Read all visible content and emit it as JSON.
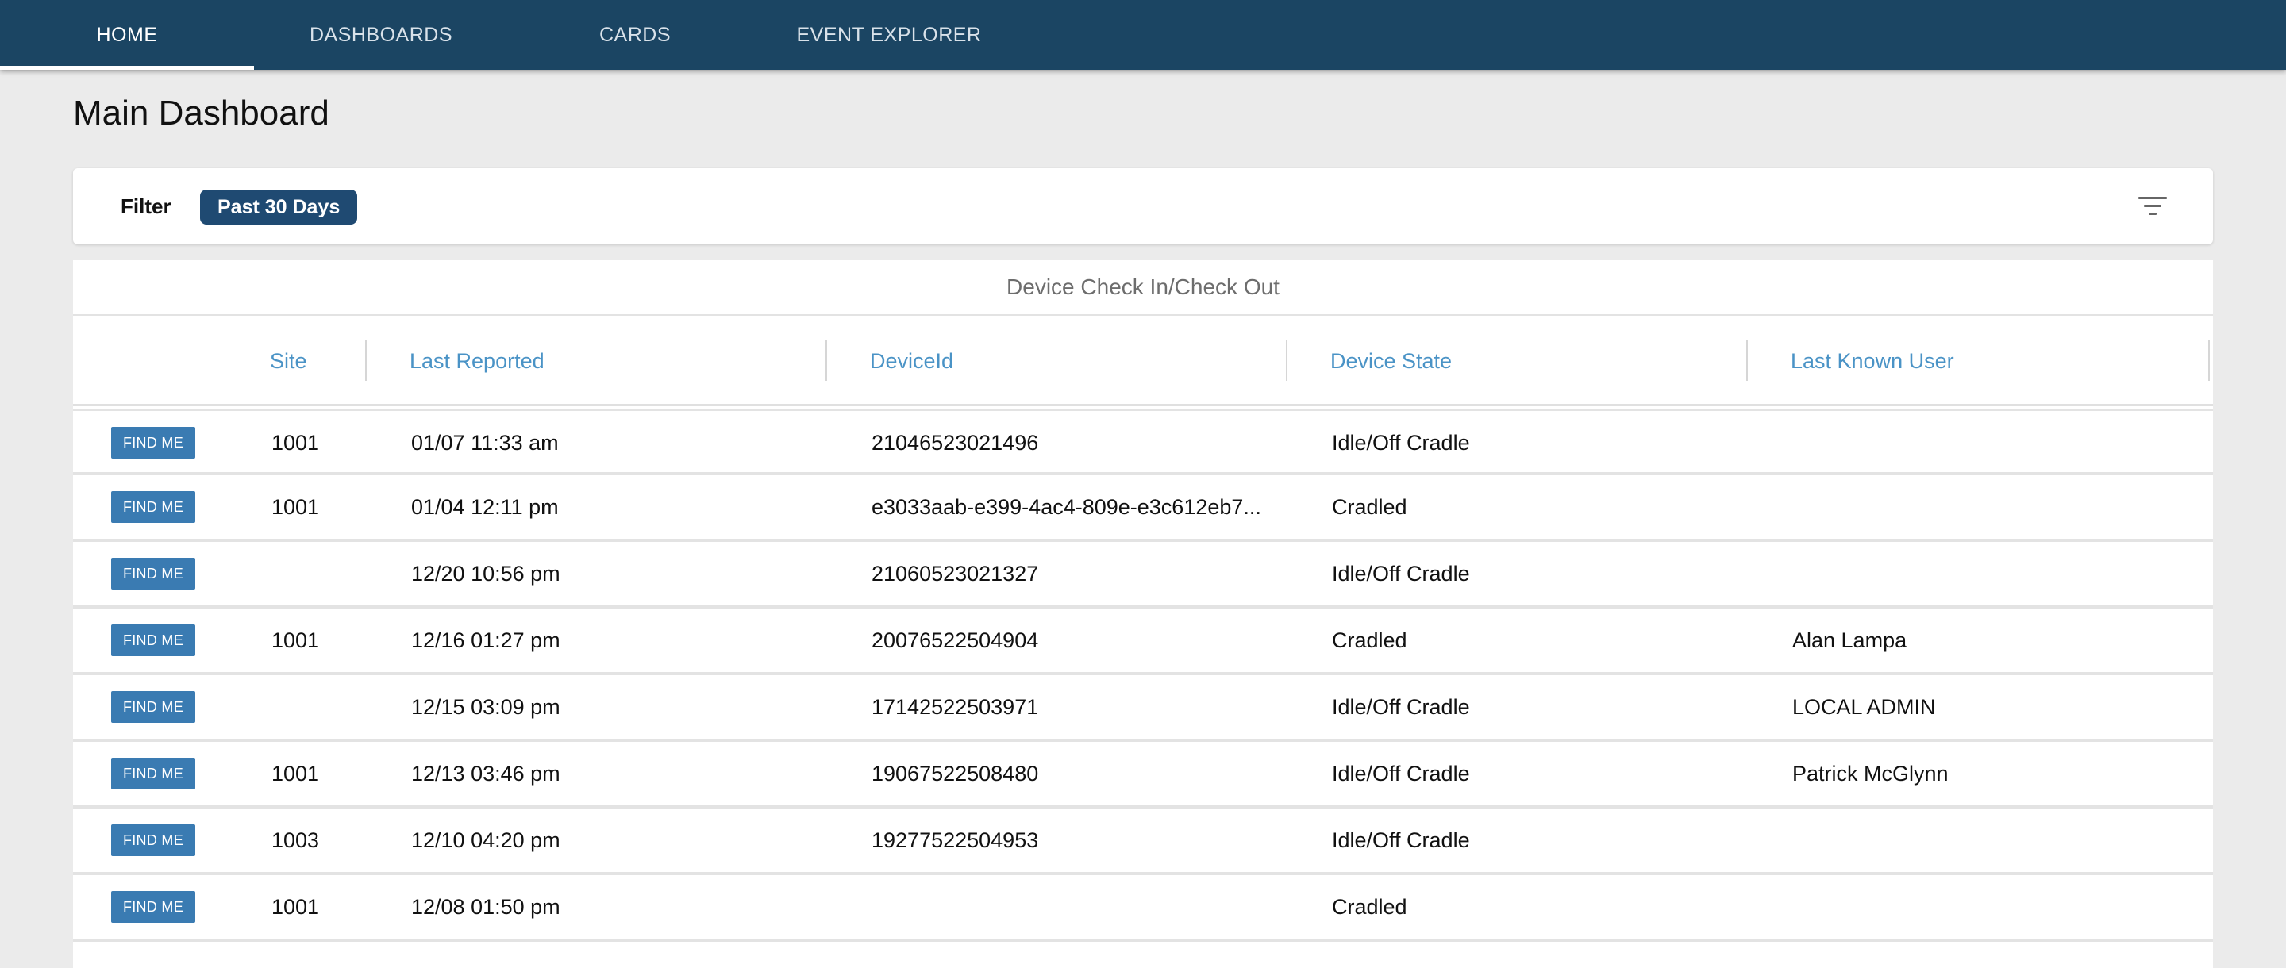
{
  "nav": {
    "tabs": [
      {
        "label": "HOME",
        "active": true
      },
      {
        "label": "DASHBOARDS",
        "active": false
      },
      {
        "label": "CARDS",
        "active": false
      },
      {
        "label": "EVENT EXPLORER",
        "active": false
      }
    ]
  },
  "page": {
    "title": "Main Dashboard"
  },
  "filter": {
    "label": "Filter",
    "chip": "Past 30 Days",
    "icon": "filter-list-icon"
  },
  "table": {
    "title": "Device Check In/Check Out",
    "columns": [
      "Site",
      "Last Reported",
      "DeviceId",
      "Device State",
      "Last Known User"
    ],
    "button_label": "FIND ME",
    "rows": [
      {
        "site": "1001",
        "last_reported": "01/07 11:33 am",
        "device_id": "21046523021496",
        "state": "Idle/Off Cradle",
        "user": ""
      },
      {
        "site": "1001",
        "last_reported": "01/04 12:11 pm",
        "device_id": "e3033aab-e399-4ac4-809e-e3c612eb7...",
        "state": "Cradled",
        "user": ""
      },
      {
        "site": "",
        "last_reported": "12/20 10:56 pm",
        "device_id": "21060523021327",
        "state": "Idle/Off Cradle",
        "user": ""
      },
      {
        "site": "1001",
        "last_reported": "12/16 01:27 pm",
        "device_id": "20076522504904",
        "state": "Cradled",
        "user": "Alan Lampa"
      },
      {
        "site": "",
        "last_reported": "12/15 03:09 pm",
        "device_id": "17142522503971",
        "state": "Idle/Off Cradle",
        "user": "LOCAL ADMIN"
      },
      {
        "site": "1001",
        "last_reported": "12/13 03:46 pm",
        "device_id": "19067522508480",
        "state": "Idle/Off Cradle",
        "user": "Patrick McGlynn"
      },
      {
        "site": "1003",
        "last_reported": "12/10 04:20 pm",
        "device_id": "19277522504953",
        "state": "Idle/Off Cradle",
        "user": ""
      },
      {
        "site": "1001",
        "last_reported": "12/08 01:50 pm",
        "device_id": "",
        "state": "Cradled",
        "user": ""
      }
    ]
  }
}
